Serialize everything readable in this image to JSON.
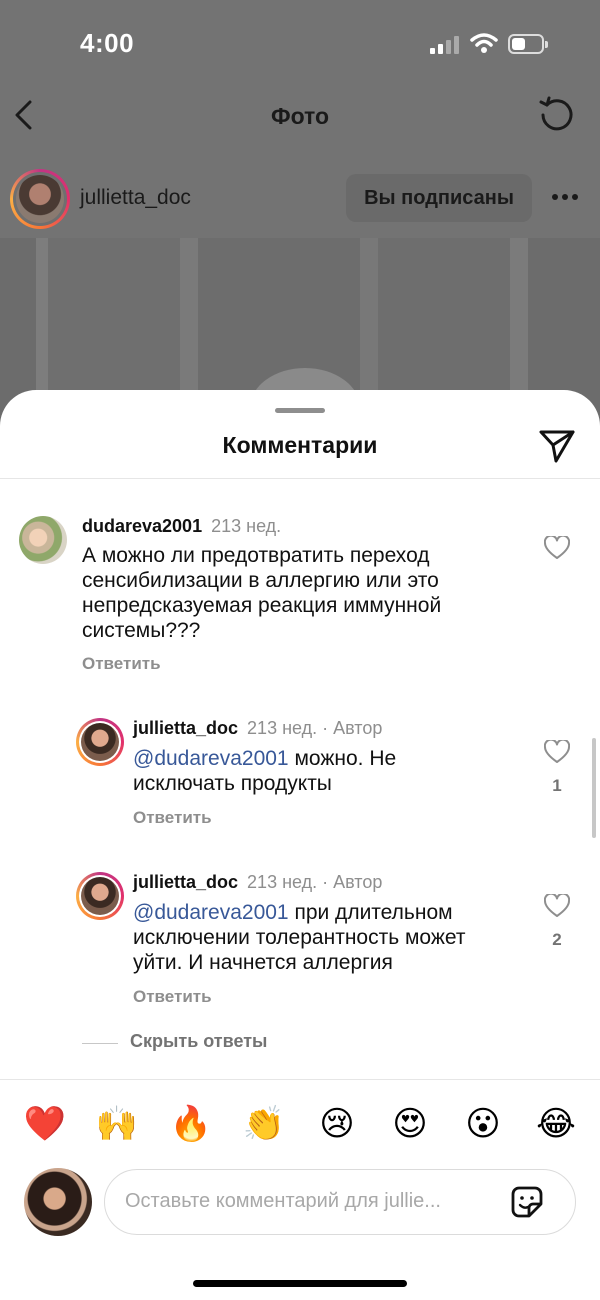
{
  "status_bar": {
    "time": "4:00"
  },
  "nav": {
    "title": "Фото"
  },
  "post": {
    "username": "jullietta_doc",
    "follow_label": "Вы подписаны"
  },
  "sheet": {
    "title": "Комментарии"
  },
  "comments": [
    {
      "username": "dudareva2001",
      "time": "213 нед.",
      "text": "А можно ли предотвратить переход сенсибилизации в аллергию или это непредсказуемая реакция иммунной системы???",
      "reply_label": "Ответить"
    },
    {
      "username": "jullietta_doc",
      "time": "213 нед. · Автор",
      "mention": "@dudareva2001",
      "text": " можно. Не исключать продукты",
      "reply_label": "Ответить",
      "likes": "1"
    },
    {
      "username": "jullietta_doc",
      "time": "213 нед. · Автор",
      "mention": "@dudareva2001",
      "text": " при длительном исключении толерантность может уйти. И начнется аллергия",
      "reply_label": "Ответить",
      "likes": "2"
    }
  ],
  "hide_replies_label": "Скрыть ответы",
  "emoji_reactions": [
    "❤️",
    "🙌",
    "🔥",
    "👏",
    "😢",
    "😍",
    "😮",
    "😂"
  ],
  "composer": {
    "placeholder": "Оставьте комментарий для jullie..."
  },
  "colors": {
    "mention": "#385898",
    "muted": "#8e8e8e",
    "overlay": "#737373"
  }
}
